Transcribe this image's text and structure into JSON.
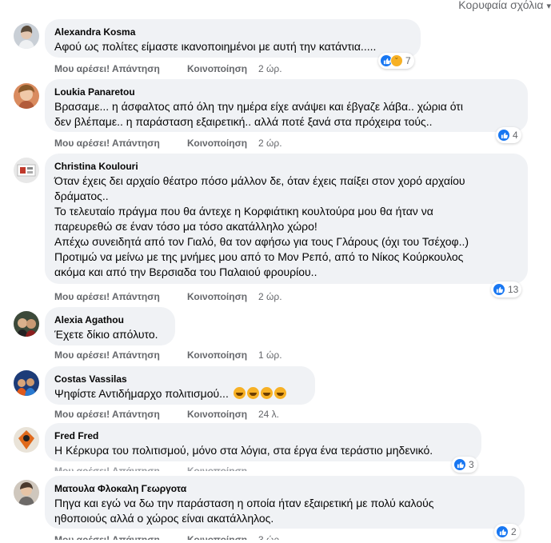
{
  "header": {
    "sort_label": "Κορυφαία σχόλια"
  },
  "actions": {
    "like": "Μου αρέσει!",
    "reply": "Απάντηση",
    "share": "Κοινοποίηση"
  },
  "comments": [
    {
      "author": "Alexandra Kosma",
      "lines": [
        "Αφού ως πολίτες είμαστε ικανοποιημένοι με αυτή την κατάντια....."
      ],
      "time": "2 ώρ.",
      "reaction_count": "7",
      "reaction_icons": [
        "like-icon",
        "sad-icon"
      ]
    },
    {
      "author": "Loukia Panaretou",
      "lines": [
        "Βρασαμε... η άσφαλτος από όλη την ημέρα είχε ανάψει και έβγαζε λάβα.. χώρια ότι",
        "δεν βλέπαμε.. η παράσταση εξαιρετική.. αλλά ποτέ ξανά στα πρόχειρα τούς.."
      ],
      "time": "2 ώρ.",
      "reaction_count": "4",
      "reaction_icons": [
        "like-icon"
      ]
    },
    {
      "author": "Christina Koulouri",
      "lines": [
        "Όταν έχεις δει αρχαίο θέατρο πόσο μάλλον δε, όταν έχεις παίξει στον χορό αρχαίου",
        "δράματος..",
        "Το τελευταίο πράγμα που θα άντεχε η Κορφιάτικη κουλτούρα μου θα ήταν να",
        "παρευρεθώ σε έναν τόσο μα τόσο ακατάλληλο χώρο!",
        "Απέχω συνειδητά από τον Γιαλό, θα τον αφήσω για τους Γλάρους (όχι του Τσέχοφ..)",
        "Προτιμώ να μείνω με της μνήμες μου από το Μον Ρεπό, από το Νίκος Κούρκουλος",
        "ακόμα και από την Βερσιαδα του Παλαιού φρουρίου.."
      ],
      "time": "2 ώρ.",
      "reaction_count": "13",
      "reaction_icons": [
        "like-icon"
      ]
    },
    {
      "author": "Alexia Agathou",
      "lines": [
        "Έχετε δίκιο απόλυτο."
      ],
      "time": "1 ώρ.",
      "reaction_count": "",
      "reaction_icons": []
    },
    {
      "author": "Costas Vassilas",
      "lines": [
        "Ψηφίστε Αντιδήμαρχο πολιτισμού..."
      ],
      "emoji_count": 4,
      "time": "24 λ.",
      "reaction_count": "",
      "reaction_icons": []
    },
    {
      "author": "Fred Fred",
      "lines": [
        "Η Κέρκυρα του πολιτισμού, μόνο στα λόγια, στα έργα ένα τεράστιο μηδενικό."
      ],
      "time": "",
      "reaction_count": "3",
      "reaction_icons": [
        "like-icon"
      ]
    },
    {
      "author": "Ματουλα Φλοκαλη Γεωργοτα",
      "lines": [
        "Πηγα και εγώ να δω την παράσταση η οποία ήταν εξαιρετική με πολύ καλούς",
        "ηθοποιούς αλλά ο χώρος είναι ακατάλληλος."
      ],
      "time": "3 ώρ.",
      "reaction_count": "2",
      "reaction_icons": [
        "like-icon"
      ]
    }
  ],
  "colors": {
    "bubble": "#f0f2f5",
    "secondary_text": "#65676b",
    "like_blue": "#1877f2",
    "emoji_yellow": "#f7b125"
  }
}
